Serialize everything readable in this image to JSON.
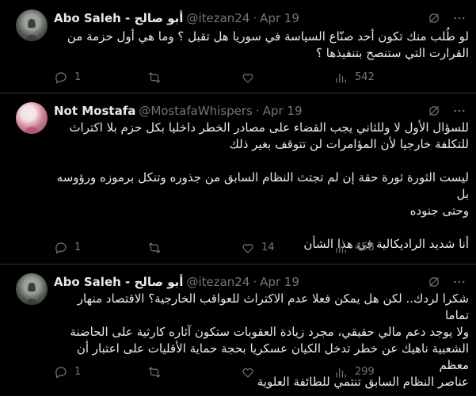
{
  "tweets": [
    {
      "name": "أبو صالح - Abo Saleh",
      "handle": "@itezan24",
      "separator": "·",
      "time": "Apr 19",
      "lines": [
        "لو طُلب منك تكون أحد صنّاع السياسة في سوريا هل تقبل ؟ وما هي أول حزمة من",
        "القرارت التي ستنصح بتنفيذها ؟"
      ],
      "replies": "1",
      "reposts": "",
      "likes": "",
      "views": "542"
    },
    {
      "name": "Not Mostafa",
      "handle": "@MostafaWhispers",
      "separator": "·",
      "time": "Apr 19",
      "lines": [
        "للسؤال الأول لا وللثاني يجب القضاء على مصادر الخطر داخليا بكل حزم بلا اكتراث",
        "للتكلفة خارجيا لأن المؤامرات لن تتوقف بغير ذلك",
        "",
        "ليست الثورة ثورة حقة إن لم تجتث النظام السابق من جذوره وتنكل برموزه ورؤوسه بل",
        "وحتى جنوده",
        "",
        "أنا شديد الراديكالية في هذا الشأن"
      ],
      "replies": "1",
      "reposts": "",
      "likes": "14",
      "views": "458"
    },
    {
      "name": "أبو صالح - Abo Saleh",
      "handle": "@itezan24",
      "separator": "·",
      "time": "Apr 19",
      "lines": [
        "شكرا لردك.. لكن هل يمكن فعلا عدم الاكتراث للعواقب الخارجية؟ الاقتصاد منهار تماما",
        "ولا يوجد دعم مالي حقيقي، مجرد زيادة العقوبات ستكون آثاره كارثية على الحاضنة",
        "الشعبية ناهيك عن خطر تدخل الكيان عسكريا بحجة حماية الأقليات على اعتبار أن معظم",
        "عناصر النظام السابق تنتمي للطائفة العلوية"
      ],
      "replies": "1",
      "reposts": "",
      "likes": "",
      "views": "299"
    }
  ],
  "icons": {
    "reply": "reply-icon",
    "repost": "repost-icon",
    "like": "heart-icon",
    "views": "views-icon",
    "grok": "grok-icon",
    "more": "more-icon"
  },
  "colors": {
    "background": "#000000",
    "text": "#e7e9ea",
    "muted": "#71767b",
    "divider": "#2f3336"
  }
}
